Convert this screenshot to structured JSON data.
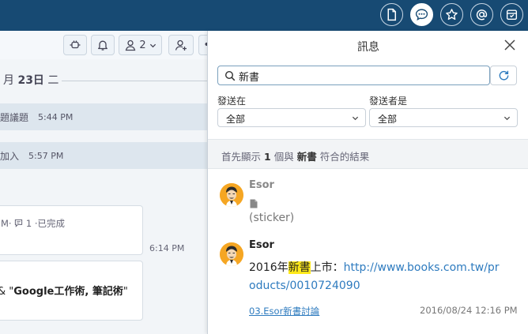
{
  "topbar": {
    "icons": [
      "document-icon",
      "chat-bubble-icon",
      "star-icon",
      "at-sign-icon",
      "inbox-icon"
    ],
    "active_icon": "chat-bubble-icon",
    "background": "#174a73"
  },
  "chat": {
    "toolbar": {
      "member_count": "2"
    },
    "date_text_prefix": "月",
    "date_day": "23日",
    "date_weekday": "二",
    "system_rows": [
      {
        "text": "題議題",
        "time": "5:44 PM"
      },
      {
        "text": "加入",
        "time": "5:57 PM"
      }
    ],
    "card1_meta": "M‧ ",
    "card1_meta_count": "1",
    "card1_meta_status": "‧已完成",
    "card1_time": "6:14 PM",
    "card2_prefix": "& \"",
    "card2_bold": "Google工作術, 筆記術",
    "card2_suffix": "\""
  },
  "panel": {
    "title": "訊息",
    "search_value": "新書",
    "filter_in_label": "發送在",
    "filter_in_value": "全部",
    "filter_sender_label": "發送者是",
    "filter_sender_value": "全部",
    "result_pre": "首先顯示",
    "result_count": "1",
    "result_mid": "個與",
    "result_term": "新書",
    "result_post": "符合的結果"
  },
  "messages": [
    {
      "sender": "Esor",
      "attachment_icon": "file-icon",
      "text": "(sticker)"
    },
    {
      "sender": "Esor",
      "text_pre": "2016年",
      "text_highlight": "新書",
      "text_post": "上市：",
      "link": "http://www.books.com.tw/products/0010724090",
      "channel": "03.Esor新書討論",
      "timestamp": "2016/08/24 12:16 PM"
    }
  ],
  "colors": {
    "highlight": "#ffe91a",
    "link": "#2e7bbf",
    "avatar": "#f5a623"
  }
}
